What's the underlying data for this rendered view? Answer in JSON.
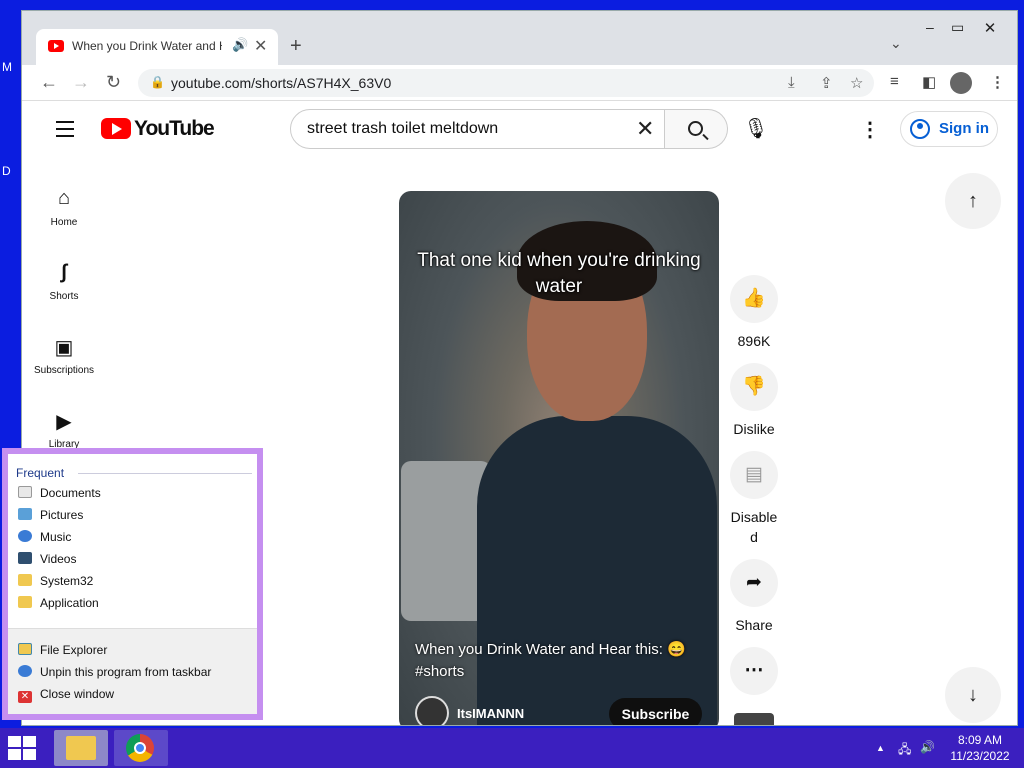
{
  "desktop": {
    "edge_letters": [
      "M",
      "D"
    ]
  },
  "browser": {
    "tab": {
      "title": "When you Drink Water and Hear this: 😄 #shorts - YouTube",
      "audio_icon": "speaker-icon"
    },
    "new_tab_label": "+",
    "url": "youtube.com/shorts/AS7H4X_63V0"
  },
  "youtube": {
    "logo_text": "YouTube",
    "search": {
      "value": "street trash toilet meltdown",
      "placeholder": "Search"
    },
    "sign_in": "Sign in",
    "sidebar": [
      {
        "label": "Home",
        "icon": "home-icon"
      },
      {
        "label": "Shorts",
        "icon": "shorts-icon"
      },
      {
        "label": "Subscriptions",
        "icon": "subscriptions-icon"
      },
      {
        "label": "Library",
        "icon": "library-icon"
      }
    ],
    "short": {
      "caption": "That one kid when you're drinking water",
      "title": "When you Drink Water and Hear this: 😄 #shorts",
      "channel": "ItsIMANNN",
      "subscribe": "Subscribe"
    },
    "actions": {
      "like": "896K",
      "dislike": "Dislike",
      "comments": "Disable d",
      "share": "Share"
    }
  },
  "jumplist": {
    "heading": "Frequent",
    "frequent": [
      "Documents",
      "Pictures",
      "Music",
      "Videos",
      "System32",
      "Application"
    ],
    "tasks": [
      "File Explorer",
      "Unpin this program from taskbar",
      "Close window"
    ]
  },
  "taskbar": {
    "time": "8:09 AM",
    "date": "11/23/2022",
    "accent": "#3b1fbf"
  }
}
